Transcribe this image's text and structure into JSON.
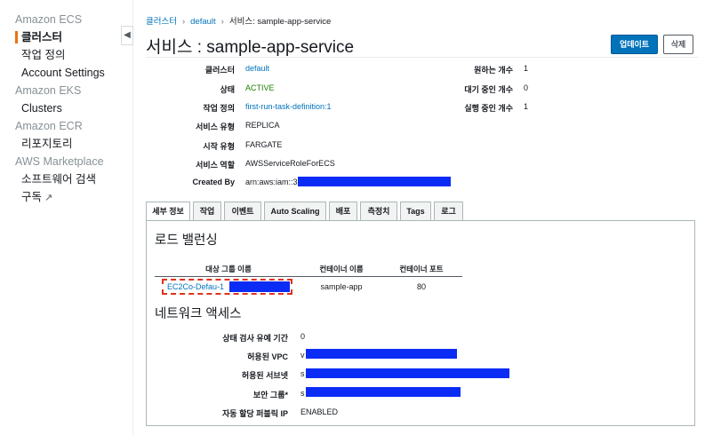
{
  "sidebar": {
    "collapse_icon": "chevron-left",
    "sections": [
      {
        "title": "Amazon ECS",
        "items": [
          {
            "label": "클러스터",
            "active": true
          },
          {
            "label": "작업 정의"
          },
          {
            "label": "Account Settings"
          }
        ]
      },
      {
        "title": "Amazon EKS",
        "items": [
          {
            "label": "Clusters"
          }
        ]
      },
      {
        "title": "Amazon ECR",
        "items": [
          {
            "label": "리포지토리"
          }
        ]
      },
      {
        "title": "AWS Marketplace",
        "items": [
          {
            "label": "소프트웨어 검색"
          },
          {
            "label": "구독",
            "icon": "external-link-icon"
          }
        ]
      }
    ]
  },
  "breadcrumb": {
    "items": [
      "클러스터",
      "default",
      "서비스: sample-app-service"
    ]
  },
  "header": {
    "title": "서비스 : sample-app-service",
    "update_label": "업데이트",
    "delete_label": "삭제"
  },
  "details_left": [
    {
      "label": "클러스터",
      "value": "default",
      "style": "link"
    },
    {
      "label": "상태",
      "value": "ACTIVE",
      "style": "green"
    },
    {
      "label": "작업 정의",
      "value": "first-run-task-definition:1",
      "style": "link"
    },
    {
      "label": "서비스 유형",
      "value": "REPLICA"
    },
    {
      "label": "시작 유형",
      "value": "FARGATE"
    },
    {
      "label": "서비스 역할",
      "value": "AWSServiceRoleForECS"
    },
    {
      "label": "Created By",
      "value": "arn:aws:iam::3",
      "redacted": true
    }
  ],
  "details_right": [
    {
      "label": "원하는 개수",
      "value": "1"
    },
    {
      "label": "대기 중인 개수",
      "value": "0"
    },
    {
      "label": "실행 중인 개수",
      "value": "1"
    }
  ],
  "tabs": [
    {
      "label": "세부 정보",
      "active": true
    },
    {
      "label": "작업"
    },
    {
      "label": "이벤트"
    },
    {
      "label": "Auto Scaling"
    },
    {
      "label": "배포"
    },
    {
      "label": "측정치"
    },
    {
      "label": "Tags"
    },
    {
      "label": "로그"
    }
  ],
  "load_balancing": {
    "title": "로드 밸런싱",
    "columns": [
      "대상 그룹 이름",
      "컨테이너 이름",
      "컨테이너 포트"
    ],
    "rows": [
      [
        "EC2Co-Defau-1",
        "sample-app",
        "80"
      ]
    ]
  },
  "network": {
    "title": "네트워크 액세스",
    "rows": [
      {
        "label": "상태 검사 유예 기간",
        "value": "0"
      },
      {
        "label": "허용된 VPC",
        "value": "v",
        "redacted": true
      },
      {
        "label": "허용된 서브넷",
        "value": "s",
        "redacted": true
      },
      {
        "label": "보안 그룹*",
        "value": "s",
        "redacted": true
      },
      {
        "label": "자동 할당 퍼블릭 IP",
        "value": "ENABLED"
      }
    ]
  }
}
